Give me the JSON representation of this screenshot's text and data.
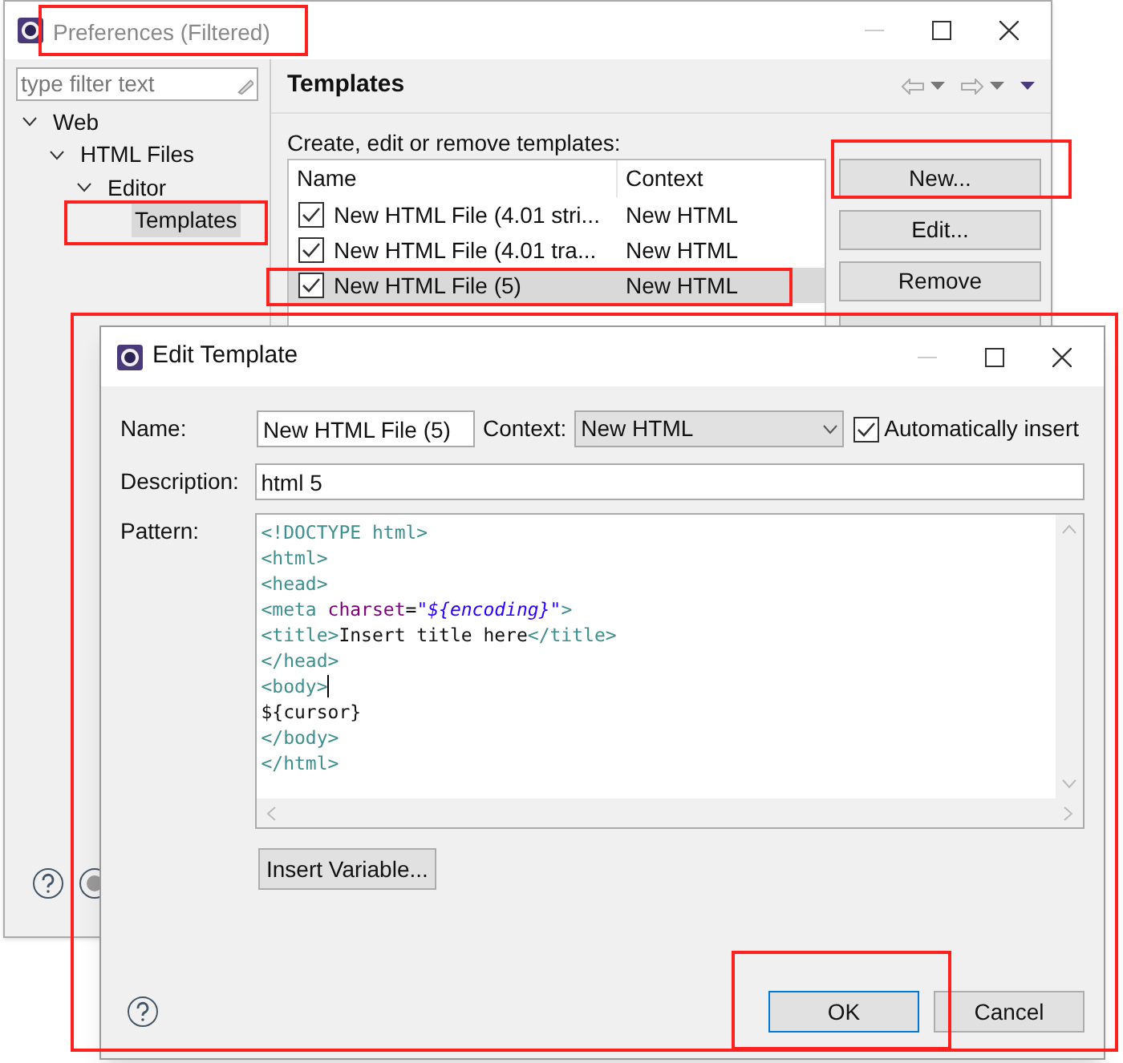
{
  "preferences_window": {
    "title": "Preferences (Filtered)",
    "filter": {
      "placeholder": "type filter text"
    },
    "tree": [
      {
        "label": "Web",
        "expanded": true,
        "selected": false,
        "children": [
          {
            "label": "HTML Files",
            "expanded": true,
            "selected": false,
            "children": [
              {
                "label": "Editor",
                "expanded": true,
                "selected": false,
                "children": [
                  {
                    "label": "Templates",
                    "selected": true
                  }
                ]
              }
            ]
          }
        ]
      }
    ],
    "page_title": "Templates",
    "description": "Create, edit or remove templates:",
    "table": {
      "columns": [
        "Name",
        "Context"
      ],
      "rows": [
        {
          "name": "New HTML File (4.01 stri...",
          "context": "New HTML",
          "checked": true,
          "selected": false
        },
        {
          "name": "New HTML File (4.01 tra...",
          "context": "New HTML",
          "checked": true,
          "selected": false
        },
        {
          "name": "New HTML File (5)",
          "context": "New HTML",
          "checked": true,
          "selected": true
        }
      ]
    },
    "buttons": [
      "New...",
      "Edit...",
      "Remove"
    ]
  },
  "edit_dialog": {
    "title": "Edit Template",
    "name_label": "Name:",
    "name_value": "New HTML File (5)",
    "context_label": "Context:",
    "context_value": "New HTML",
    "auto_insert": {
      "label": "Automatically insert",
      "checked": true
    },
    "description_label": "Description:",
    "description_value": "html 5",
    "pattern_label": "Pattern:",
    "pattern_lines": [
      {
        "caret": false,
        "segments": [
          {
            "kind": "tag",
            "text": "<!DOCTYPE html>"
          }
        ]
      },
      {
        "caret": false,
        "segments": [
          {
            "kind": "tag",
            "text": "<html>"
          }
        ]
      },
      {
        "caret": false,
        "segments": [
          {
            "kind": "tag",
            "text": "<head>"
          }
        ]
      },
      {
        "caret": false,
        "segments": [
          {
            "kind": "tag",
            "text": "<meta "
          },
          {
            "kind": "attr",
            "text": "charset"
          },
          {
            "kind": "plain",
            "text": "="
          },
          {
            "kind": "string",
            "text": "\"${encoding}\""
          },
          {
            "kind": "tag",
            "text": ">"
          }
        ]
      },
      {
        "caret": false,
        "segments": [
          {
            "kind": "tag",
            "text": "<title>"
          },
          {
            "kind": "plain",
            "text": "Insert title here"
          },
          {
            "kind": "tag",
            "text": "</title>"
          }
        ]
      },
      {
        "caret": false,
        "segments": [
          {
            "kind": "tag",
            "text": "</head>"
          }
        ]
      },
      {
        "caret": true,
        "segments": [
          {
            "kind": "tag",
            "text": "<body>"
          }
        ]
      },
      {
        "caret": false,
        "segments": [
          {
            "kind": "plain",
            "text": "${cursor}"
          }
        ]
      },
      {
        "caret": false,
        "segments": [
          {
            "kind": "tag",
            "text": "</body>"
          }
        ]
      },
      {
        "caret": false,
        "segments": [
          {
            "kind": "tag",
            "text": "</html>"
          }
        ]
      }
    ],
    "insert_variable": "Insert Variable...",
    "ok": "OK",
    "cancel": "Cancel"
  }
}
